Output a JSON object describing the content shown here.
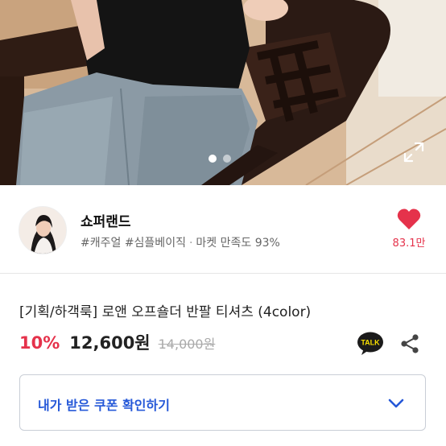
{
  "shop": {
    "name": "쇼퍼랜드",
    "tags": "#캐주얼 #심플베이직",
    "satisfaction": "마켓 만족도 93%",
    "separator": "·",
    "likes": "83.1만"
  },
  "product": {
    "title": "[기획/하객룩] 로앤 오프숄더 반팔 티셔츠 (4color)",
    "discount": "10%",
    "price": "12,600원",
    "original_price": "14,000원"
  },
  "coupon": {
    "label": "내가 받은 쿠폰 확인하기"
  },
  "talk_badge": "TALK",
  "carousel": {
    "page_count": 2,
    "active_index": 0
  },
  "colors": {
    "accent_red": "#e5324b",
    "coupon_blue": "#2558d8",
    "talk_yellow": "#f9e000"
  },
  "icons": {
    "expand": "expand-icon",
    "like": "heart-icon",
    "talk": "kakao-talk-icon",
    "share": "share-icon",
    "coupon_chevron": "chevron-down-icon"
  }
}
